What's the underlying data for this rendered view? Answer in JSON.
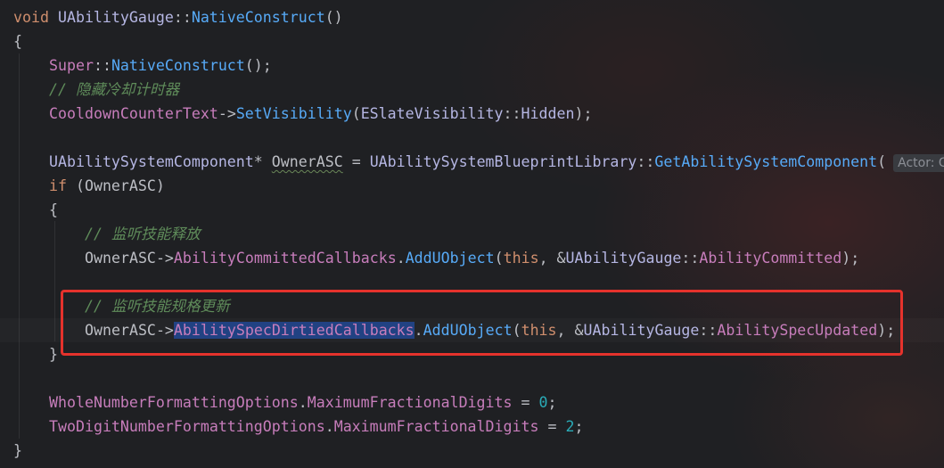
{
  "editor": {
    "lines": [
      {
        "tokens": [
          {
            "t": "void",
            "c": "kw"
          },
          {
            "t": " ",
            "c": "pl"
          },
          {
            "t": "UAbilityGauge",
            "c": "cls"
          },
          {
            "t": "::",
            "c": "pl"
          },
          {
            "t": "NativeConstruct",
            "c": "fn"
          },
          {
            "t": "()",
            "c": "pl"
          }
        ]
      },
      {
        "tokens": [
          {
            "t": "{",
            "c": "pl"
          }
        ]
      },
      {
        "tokens": [
          {
            "t": "Super",
            "c": "fld"
          },
          {
            "t": "::",
            "c": "pl"
          },
          {
            "t": "NativeConstruct",
            "c": "fn"
          },
          {
            "t": "();",
            "c": "pl"
          }
        ]
      },
      {
        "tokens": [
          {
            "t": "// 隐藏冷却计时器",
            "c": "cmt"
          }
        ]
      },
      {
        "tokens": [
          {
            "t": "CooldownCounterText",
            "c": "fld"
          },
          {
            "t": "->",
            "c": "pl"
          },
          {
            "t": "SetVisibility",
            "c": "fn"
          },
          {
            "t": "(",
            "c": "pl"
          },
          {
            "t": "ESlateVisibility",
            "c": "ty"
          },
          {
            "t": "::",
            "c": "pl"
          },
          {
            "t": "Hidden",
            "c": "cls"
          },
          {
            "t": ");",
            "c": "pl"
          }
        ]
      },
      {
        "tokens": []
      },
      {
        "tokens": [
          {
            "t": "UAbilitySystemComponent",
            "c": "cls"
          },
          {
            "t": "* ",
            "c": "pl"
          },
          {
            "t": "OwnerASC",
            "c": "lv"
          },
          {
            "t": " = ",
            "c": "pl"
          },
          {
            "t": "UAbilitySystemBlueprintLibrary",
            "c": "cls"
          },
          {
            "t": "::",
            "c": "pl"
          },
          {
            "t": "GetAbilitySystemComponent",
            "c": "fn"
          },
          {
            "t": "(",
            "c": "pl"
          }
        ],
        "hint": "Actor: G"
      },
      {
        "tokens": [
          {
            "t": "if",
            "c": "kw"
          },
          {
            "t": " (OwnerASC)",
            "c": "pl"
          }
        ]
      },
      {
        "tokens": [
          {
            "t": "{",
            "c": "pl"
          }
        ]
      },
      {
        "tokens": [
          {
            "t": "// 监听技能释放",
            "c": "cmt"
          }
        ]
      },
      {
        "tokens": [
          {
            "t": "OwnerASC",
            "c": "pl"
          },
          {
            "t": "->",
            "c": "pl"
          },
          {
            "t": "AbilityCommittedCallbacks",
            "c": "fld"
          },
          {
            "t": ".",
            "c": "pl"
          },
          {
            "t": "AddUObject",
            "c": "fn"
          },
          {
            "t": "(",
            "c": "pl"
          },
          {
            "t": "this",
            "c": "kw"
          },
          {
            "t": ", &",
            "c": "pl"
          },
          {
            "t": "UAbilityGauge",
            "c": "cls"
          },
          {
            "t": "::",
            "c": "pl"
          },
          {
            "t": "AbilityCommitted",
            "c": "fld"
          },
          {
            "t": ");",
            "c": "pl"
          }
        ]
      },
      {
        "tokens": []
      },
      {
        "tokens": [
          {
            "t": "// 监听技能规格更新",
            "c": "cmt"
          }
        ]
      },
      {
        "tokens": [
          {
            "t": "OwnerASC",
            "c": "pl"
          },
          {
            "t": "->",
            "c": "pl"
          },
          {
            "t": "AbilitySpecDirtiedCallbacks",
            "c": "fld hl"
          },
          {
            "t": ".",
            "c": "pl"
          },
          {
            "t": "AddUObject",
            "c": "fn"
          },
          {
            "t": "(",
            "c": "pl"
          },
          {
            "t": "this",
            "c": "kw"
          },
          {
            "t": ", &",
            "c": "pl"
          },
          {
            "t": "UAbilityGauge",
            "c": "cls"
          },
          {
            "t": "::",
            "c": "pl"
          },
          {
            "t": "AbilitySpecUpdated",
            "c": "fld"
          },
          {
            "t": ");",
            "c": "pl"
          }
        ]
      },
      {
        "tokens": [
          {
            "t": "}",
            "c": "pl"
          }
        ]
      },
      {
        "tokens": []
      },
      {
        "tokens": [
          {
            "t": "WholeNumberFormattingOptions",
            "c": "fld"
          },
          {
            "t": ".",
            "c": "pl"
          },
          {
            "t": "MaximumFractionalDigits",
            "c": "fld"
          },
          {
            "t": " = ",
            "c": "pl"
          },
          {
            "t": "0",
            "c": "num"
          },
          {
            "t": ";",
            "c": "pl"
          }
        ]
      },
      {
        "tokens": [
          {
            "t": "TwoDigitNumberFormattingOptions",
            "c": "fld"
          },
          {
            "t": ".",
            "c": "pl"
          },
          {
            "t": "MaximumFractionalDigits",
            "c": "fld"
          },
          {
            "t": " = ",
            "c": "pl"
          },
          {
            "t": "2",
            "c": "num"
          },
          {
            "t": ";",
            "c": "pl"
          }
        ]
      },
      {
        "tokens": [
          {
            "t": "}",
            "c": "pl"
          }
        ]
      }
    ]
  },
  "colors": {
    "annotation_box": "#e5322c",
    "selection_highlight": "#214283"
  }
}
